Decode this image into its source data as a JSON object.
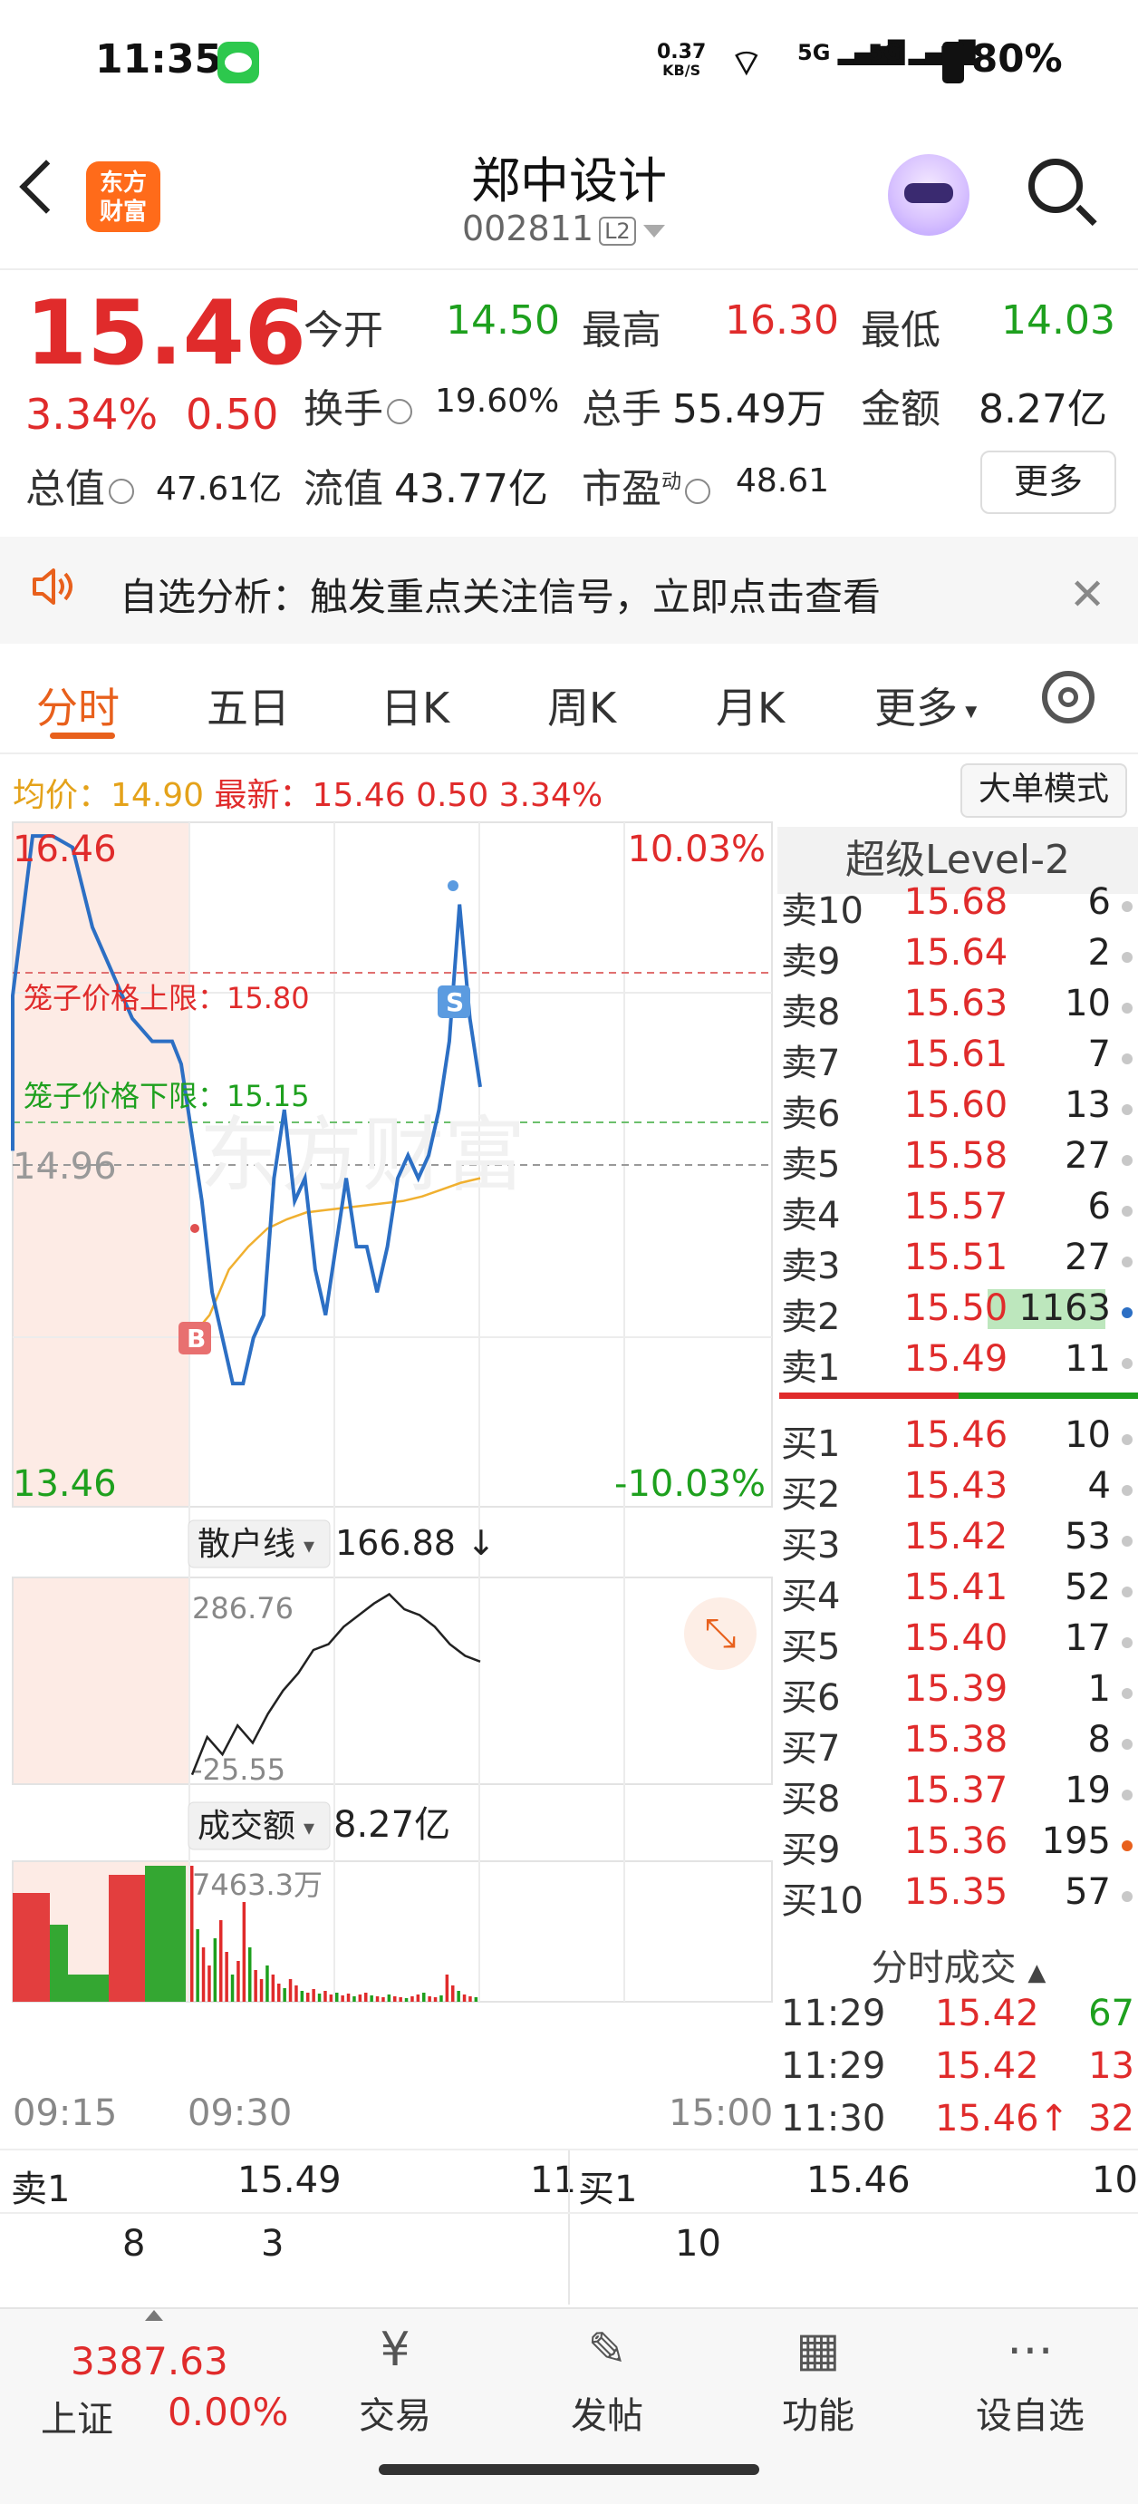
{
  "status": {
    "time": "11:35",
    "net_speed": "0.37",
    "net_unit": "KB/S",
    "signal1": "5G",
    "signal2": "5G",
    "battery": "80%"
  },
  "header": {
    "logo_line1": "东方",
    "logo_line2": "财富",
    "stock_name": "郑中设计",
    "stock_code": "002811",
    "level_badge": "L2"
  },
  "quote": {
    "price": "15.46",
    "change_pct": "3.34%",
    "change": "0.50",
    "open_label": "今开",
    "open": "14.50",
    "high_label": "最高",
    "high": "16.30",
    "low_label": "最低",
    "low": "14.03",
    "turnover_label": "换手",
    "turnover": "19.60%",
    "volume_label": "总手",
    "volume": "55.49万",
    "amount_label": "金额",
    "amount": "8.27亿",
    "mktcap_label": "总值",
    "mktcap": "47.61亿",
    "float_label": "流值",
    "float": "43.77亿",
    "pe_label": "市盈",
    "pe_sup": "动",
    "pe": "48.61",
    "more": "更多"
  },
  "alert": {
    "text": "自选分析：触发重点关注信号，立即点击查看"
  },
  "tabs": [
    "分时",
    "五日",
    "日K",
    "周K",
    "月K",
    "更多"
  ],
  "summary": {
    "avg_label": "均价：",
    "avg": "14.90",
    "latest_label": "最新：",
    "latest": "15.46",
    "change": "0.50",
    "pct": "3.34%",
    "big_order": "大单模式"
  },
  "chart_data": {
    "type": "line",
    "y_top": "16.46",
    "y_bottom": "13.46",
    "pct_top": "10.03%",
    "pct_bottom": "-10.03%",
    "prev_close": "14.96",
    "cage_upper": "笼子价格上限：15.80",
    "cage_lower": "笼子价格下限：15.15",
    "ylim": [
      13.46,
      16.46
    ],
    "x_labels": [
      "09:15",
      "09:30",
      "15:00"
    ],
    "price_series": [
      15.7,
      16.4,
      16.4,
      16.35,
      16.0,
      15.8,
      15.6,
      15.5,
      15.5,
      15.4,
      15.1,
      14.8,
      14.4,
      14.2,
      14.0,
      14.0,
      14.2,
      14.3,
      14.9,
      15.2,
      14.8,
      14.9,
      14.5,
      14.3,
      14.6,
      14.9,
      14.6,
      14.6,
      14.4,
      14.6,
      14.9,
      15.0,
      14.9,
      15.0,
      15.2,
      15.5,
      16.1,
      15.6,
      15.3
    ],
    "avg_series": [
      14.2,
      14.3,
      14.5,
      14.6,
      14.68,
      14.72,
      14.75,
      14.76,
      14.77,
      14.78,
      14.79,
      14.8,
      14.82,
      14.85,
      14.88,
      14.9
    ],
    "markers": {
      "buy": "B",
      "sell": "S"
    },
    "retail_label": "散户线",
    "retail_value": "166.88",
    "retail_top": "286.76",
    "retail_bottom": "-25.55",
    "amount_label": "成交额",
    "amount_value": "8.27亿",
    "amount_max": "7463.3万"
  },
  "orderbook": {
    "title": "超级Level-2",
    "asks": [
      {
        "label": "卖10",
        "price": "15.68",
        "vol": "6"
      },
      {
        "label": "卖9",
        "price": "15.64",
        "vol": "2"
      },
      {
        "label": "卖8",
        "price": "15.63",
        "vol": "10"
      },
      {
        "label": "卖7",
        "price": "15.61",
        "vol": "7"
      },
      {
        "label": "卖6",
        "price": "15.60",
        "vol": "13"
      },
      {
        "label": "卖5",
        "price": "15.58",
        "vol": "27"
      },
      {
        "label": "卖4",
        "price": "15.57",
        "vol": "6"
      },
      {
        "label": "卖3",
        "price": "15.51",
        "vol": "27"
      },
      {
        "label": "卖2",
        "price": "15.50",
        "vol": "1163"
      },
      {
        "label": "卖1",
        "price": "15.49",
        "vol": "11"
      }
    ],
    "bids": [
      {
        "label": "买1",
        "price": "15.46",
        "vol": "10"
      },
      {
        "label": "买2",
        "price": "15.43",
        "vol": "4"
      },
      {
        "label": "买3",
        "price": "15.42",
        "vol": "53"
      },
      {
        "label": "买4",
        "price": "15.41",
        "vol": "52"
      },
      {
        "label": "买5",
        "price": "15.40",
        "vol": "17"
      },
      {
        "label": "买6",
        "price": "15.39",
        "vol": "1"
      },
      {
        "label": "买7",
        "price": "15.38",
        "vol": "8"
      },
      {
        "label": "买8",
        "price": "15.37",
        "vol": "19"
      },
      {
        "label": "买9",
        "price": "15.36",
        "vol": "195"
      },
      {
        "label": "买10",
        "price": "15.35",
        "vol": "57"
      }
    ],
    "ticks_title": "分时成交",
    "ticks": [
      {
        "time": "11:29",
        "price": "15.42",
        "vol": "67",
        "dir": "buy"
      },
      {
        "time": "11:29",
        "price": "15.42",
        "vol": "13",
        "dir": "sell"
      },
      {
        "time": "11:30",
        "price": "15.46↑",
        "vol": "32",
        "dir": "sell"
      }
    ]
  },
  "bottom_book": {
    "ask_label": "卖1",
    "ask_price": "15.49",
    "ask_vol": "11",
    "ask_q1": "8",
    "ask_q2": "3",
    "bid_label": "买1",
    "bid_price": "15.46",
    "bid_vol": "10",
    "bid_q1": "10"
  },
  "nav": {
    "index_value": "3387.63",
    "index_name": "上证",
    "index_pct": "0.00%",
    "items": [
      "交易",
      "发帖",
      "功能",
      "设自选"
    ]
  }
}
